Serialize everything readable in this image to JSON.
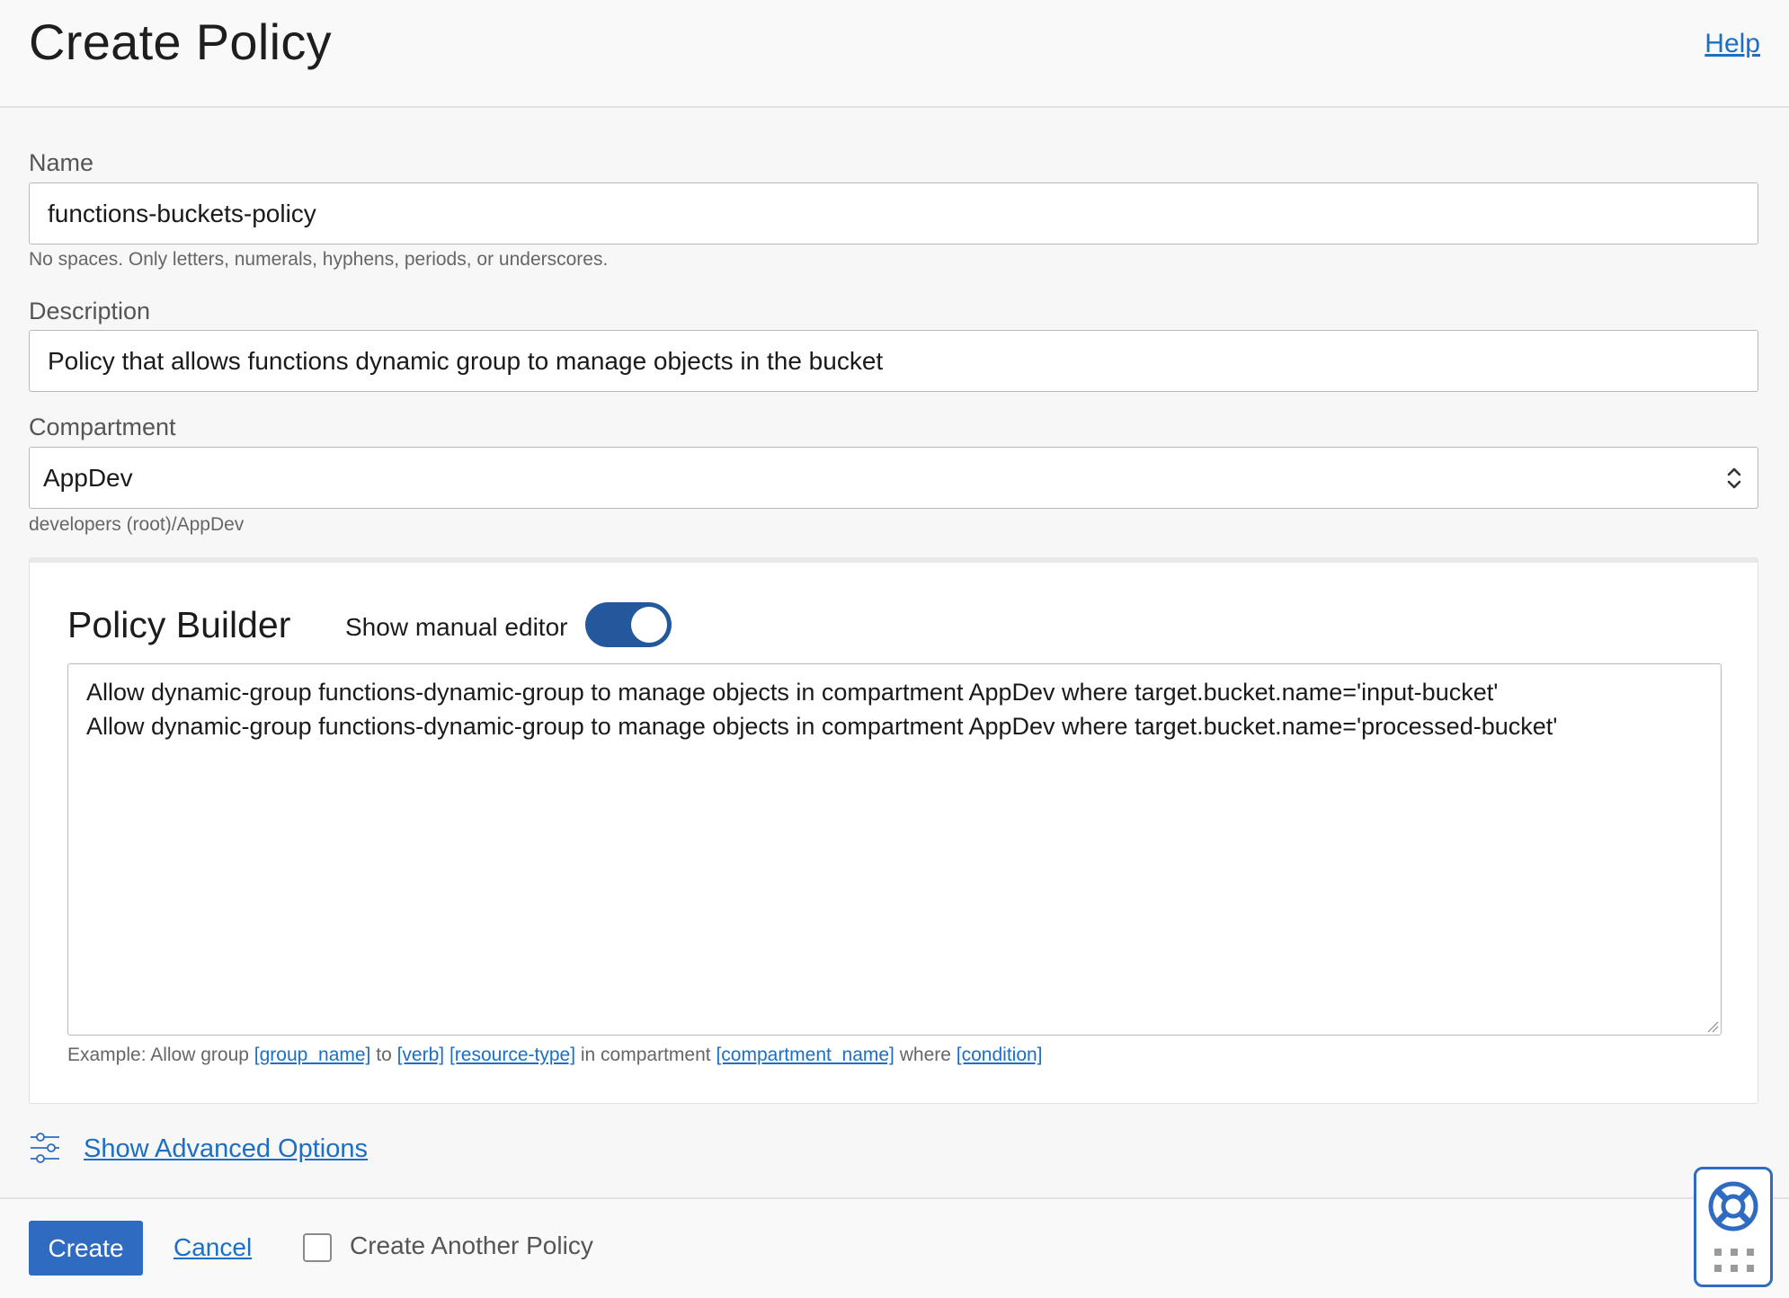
{
  "header": {
    "title": "Create Policy",
    "help_link": "Help"
  },
  "form": {
    "name": {
      "label": "Name",
      "value": "functions-buckets-policy",
      "hint": "No spaces. Only letters, numerals, hyphens, periods, or underscores."
    },
    "description": {
      "label": "Description",
      "value": "Policy that allows functions dynamic group to manage objects in the bucket"
    },
    "compartment": {
      "label": "Compartment",
      "value": "AppDev",
      "path": "developers (root)/AppDev"
    }
  },
  "policy_builder": {
    "title": "Policy Builder",
    "manual_editor_label": "Show manual editor",
    "manual_editor_on": true,
    "statements": [
      "Allow dynamic-group functions-dynamic-group to manage objects in compartment AppDev where target.bucket.name='input-bucket'",
      "Allow dynamic-group functions-dynamic-group to manage objects in compartment AppDev where target.bucket.name='processed-bucket'"
    ],
    "example": {
      "prefix": "Example: Allow group",
      "group_name": "[group_name]",
      "to": "to",
      "verb": "[verb]",
      "resource_type": "[resource-type]",
      "in_compartment": "in compartment",
      "compartment_name": "[compartment_name]",
      "where": "where",
      "condition": "[condition]"
    }
  },
  "advanced_options_link": "Show Advanced Options",
  "footer": {
    "create_button": "Create",
    "cancel_link": "Cancel",
    "create_another_label": "Create Another Policy",
    "create_another_checked": false
  },
  "colors": {
    "accent": "#2f6bc1",
    "link": "#1c6fc4",
    "toggle_on": "#23589c"
  },
  "icons": {
    "advanced_options": "sliders-icon",
    "select": "chevron-up-down-icon",
    "help_widget": "lifebuoy-icon",
    "help_widget_secondary": "grid-dots-icon"
  }
}
